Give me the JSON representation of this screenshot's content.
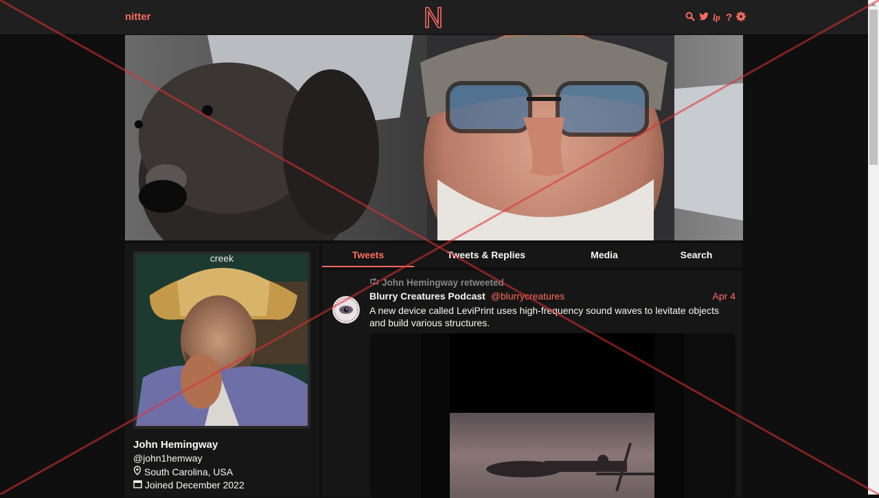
{
  "nav": {
    "brand": "nitter",
    "logo_letter": "N"
  },
  "icons": {
    "search": "search-icon",
    "twitter": "bird-icon",
    "rss": "rss-icon",
    "help": "question-icon",
    "settings": "gear-icon"
  },
  "colors": {
    "accent": "#ff6c60",
    "background": "#0f0f0f",
    "panel": "#161616",
    "navbar": "#1f1f1f",
    "text": "#f8f8f2",
    "muted": "#888889"
  },
  "profile": {
    "avatar_caption": "creek",
    "name": "John Hemingway",
    "handle": "@john1hemway",
    "location": "South Carolina, USA",
    "joined": "Joined December 2022"
  },
  "tabs": [
    {
      "label": "Tweets",
      "active": true
    },
    {
      "label": "Tweets & Replies",
      "active": false
    },
    {
      "label": "Media",
      "active": false
    },
    {
      "label": "Search",
      "active": false
    }
  ],
  "tweet": {
    "retweet_label": "John Hemingway retweeted",
    "fullname": "Blurry Creatures Podcast",
    "username": "@blurrycreatures",
    "date": "Apr 4",
    "text": "A new device called LeviPrint uses high-frequency sound waves to levitate objects and build various structures.",
    "avatar_text": "BLURRY CREATURES"
  }
}
